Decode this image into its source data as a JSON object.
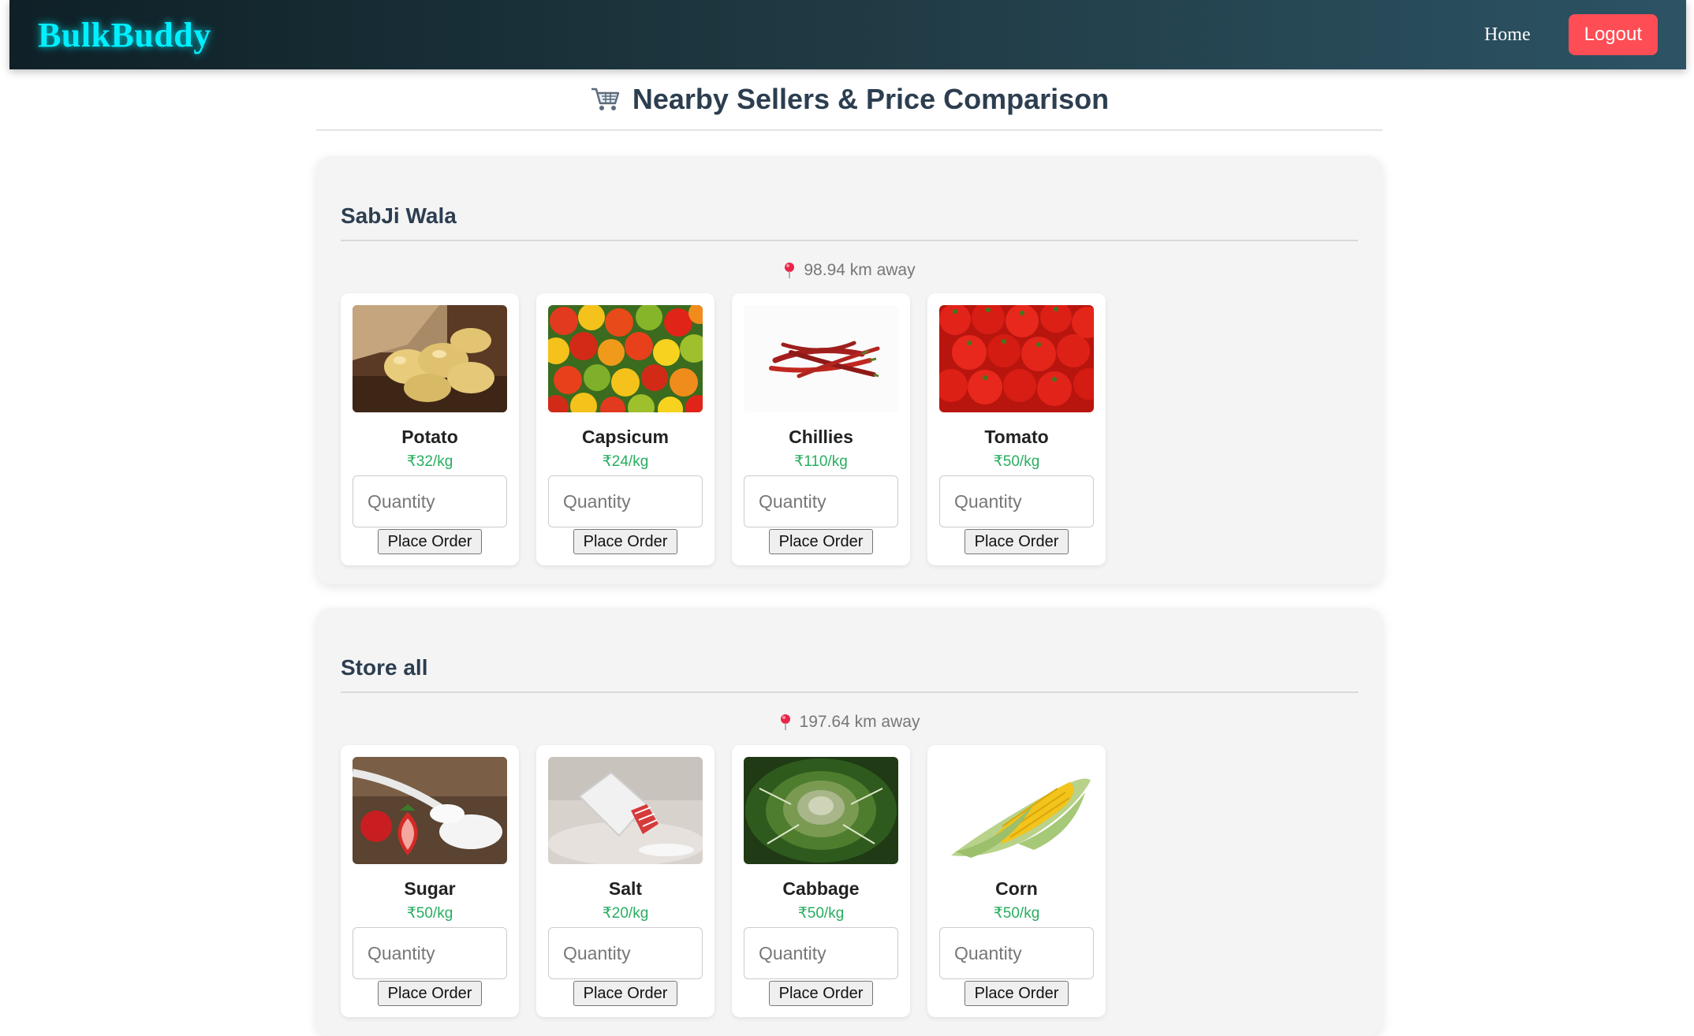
{
  "nav": {
    "brand": "BulkBuddy",
    "home_label": "Home",
    "logout_label": "Logout"
  },
  "page": {
    "title": "Nearby Sellers & Price Comparison",
    "title_icon": "shopping-cart-icon"
  },
  "colors": {
    "brand": "#00f0ff",
    "logout": "#ff4d55",
    "price": "#27ae60",
    "nav_gradient": [
      "#0f2027",
      "#203a43",
      "#2c5364"
    ]
  },
  "sellers": [
    {
      "name": "SabJi Wala",
      "distance": "98.94 km away",
      "products": [
        {
          "name": "Potato",
          "price": "₹32/kg",
          "placeholder": "Quantity",
          "button": "Place Order",
          "image": "potato-image"
        },
        {
          "name": "Capsicum",
          "price": "₹24/kg",
          "placeholder": "Quantity",
          "button": "Place Order",
          "image": "capsicum-image"
        },
        {
          "name": "Chillies",
          "price": "₹110/kg",
          "placeholder": "Quantity",
          "button": "Place Order",
          "image": "chillies-image"
        },
        {
          "name": "Tomato",
          "price": "₹50/kg",
          "placeholder": "Quantity",
          "button": "Place Order",
          "image": "tomato-image"
        }
      ]
    },
    {
      "name": "Store all",
      "distance": "197.64 km away",
      "products": [
        {
          "name": "Sugar",
          "price": "₹50/kg",
          "placeholder": "Quantity",
          "button": "Place Order",
          "image": "sugar-image"
        },
        {
          "name": "Salt",
          "price": "₹20/kg",
          "placeholder": "Quantity",
          "button": "Place Order",
          "image": "salt-image"
        },
        {
          "name": "Cabbage",
          "price": "₹50/kg",
          "placeholder": "Quantity",
          "button": "Place Order",
          "image": "cabbage-image"
        },
        {
          "name": "Corn",
          "price": "₹50/kg",
          "placeholder": "Quantity",
          "button": "Place Order",
          "image": "corn-image"
        }
      ]
    }
  ]
}
